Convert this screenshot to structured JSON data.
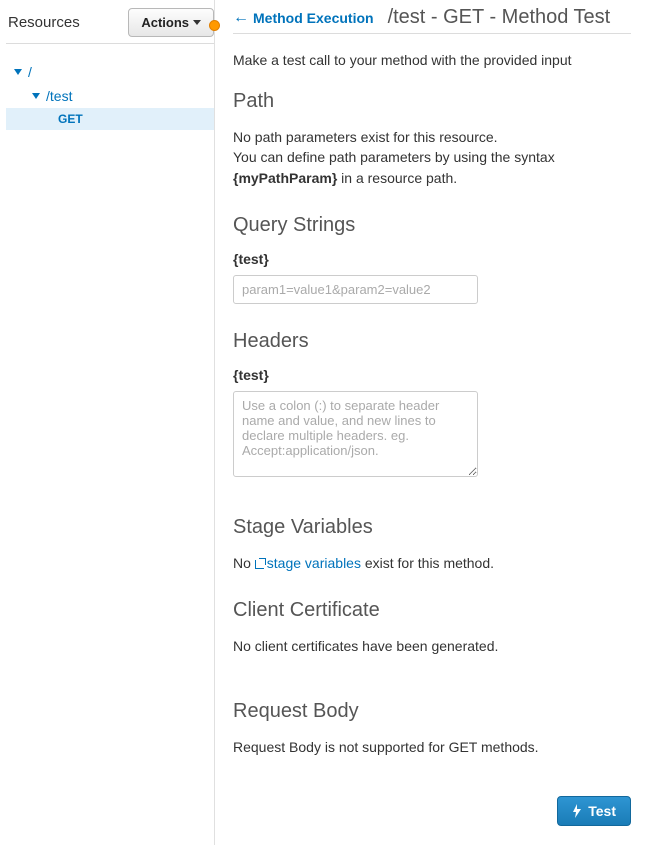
{
  "sidebar": {
    "title": "Resources",
    "actions_label": "Actions",
    "tree": {
      "root": "/",
      "child": "/test",
      "method": "GET"
    }
  },
  "header": {
    "back_label": "Method Execution",
    "title": "/test - GET - Method Test"
  },
  "intro": "Make a test call to your method with the provided input",
  "path": {
    "heading": "Path",
    "text_before": "No path parameters exist for this resource.\nYou can define path parameters by using the syntax ",
    "bold": "{myPathParam}",
    "text_after": " in a resource path."
  },
  "query": {
    "heading": "Query Strings",
    "label": "{test}",
    "placeholder": "param1=value1&param2=value2",
    "value": ""
  },
  "headers_section": {
    "heading": "Headers",
    "label": "{test}",
    "placeholder": "Use a colon (:) to separate header name and value, and new lines to declare multiple headers. eg. Accept:application/json.",
    "value": ""
  },
  "stage": {
    "heading": "Stage Variables",
    "text_before": "No ",
    "link": "stage variables",
    "text_after": " exist for this method."
  },
  "cert": {
    "heading": "Client Certificate",
    "text": "No client certificates have been generated."
  },
  "body": {
    "heading": "Request Body",
    "text": "Request Body is not supported for GET methods."
  },
  "footer": {
    "test_label": "Test"
  }
}
